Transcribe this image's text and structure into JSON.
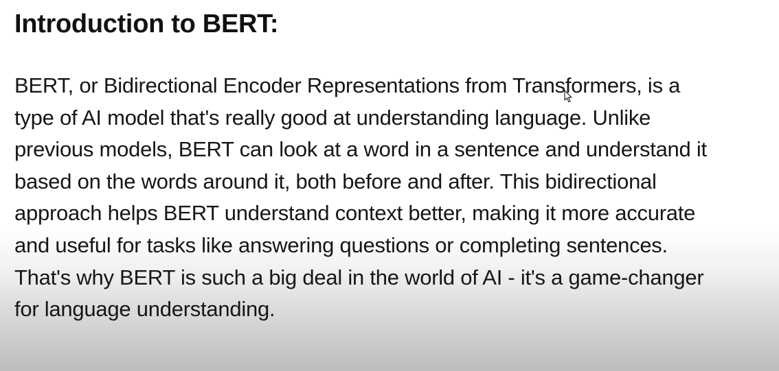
{
  "document": {
    "title": "Introduction to BERT:",
    "lines": [
      "BERT, or Bidirectional Encoder Representations from Transformers, is a",
      "type of AI model that's really good at understanding language. Unlike",
      "previous models, BERT can look at a word in a sentence and understand it",
      "based on the words around it, both before and after. This bidirectional",
      "approach helps BERT understand context better, making it more accurate",
      "and useful for tasks like answering questions or completing sentences.",
      "That's why BERT is such a big deal in the world of AI - it's a game-changer",
      "for language understanding."
    ]
  },
  "cursor": {
    "icon": "mouse-pointer-icon"
  },
  "colors": {
    "text": "#111111",
    "background_top": "#ffffff",
    "background_bottom": "#bdbdbd"
  }
}
